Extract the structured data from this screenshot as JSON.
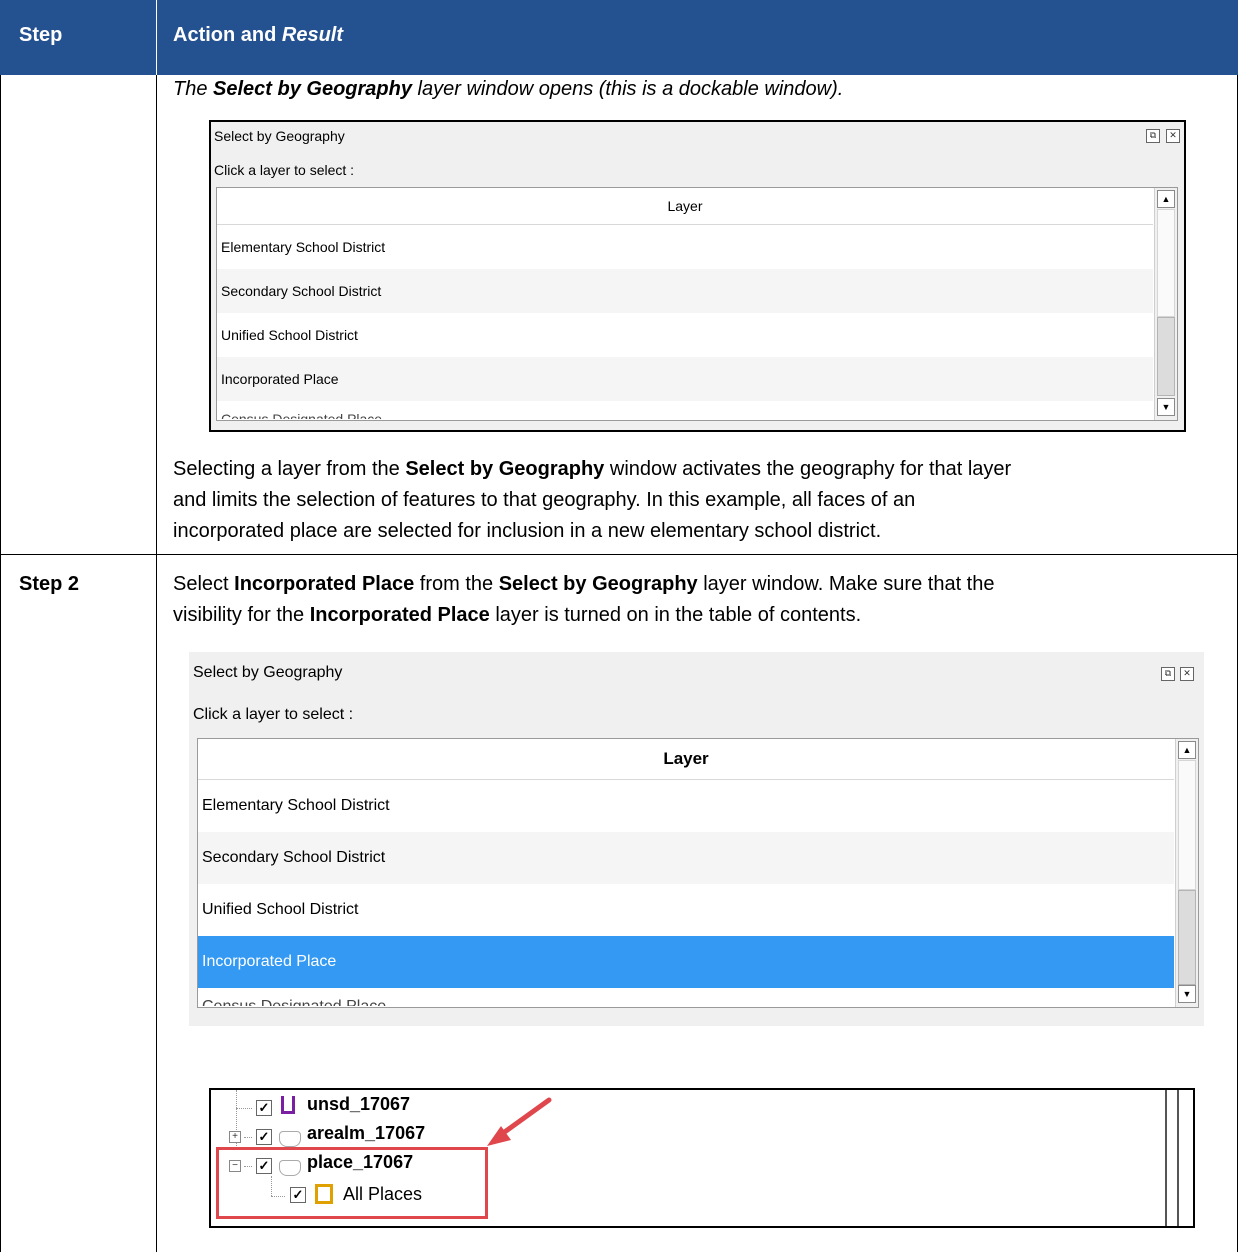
{
  "header": {
    "step_col": "Step",
    "action_col_prefix": "Action and ",
    "action_col_italic": "Result"
  },
  "row1": {
    "result_pre": "The ",
    "result_bold": "Select by Geography",
    "result_post": " layer window opens (this is a dockable window).",
    "explain_pre": "Selecting a layer from the ",
    "explain_bold": "Select by Geography",
    "explain_post_line1": " window activates the geography for that layer",
    "explain_line2": "and limits the selection of features to that geography. In this example, all faces of an",
    "explain_line3": "incorporated place are selected for inclusion in a new elementary school district."
  },
  "row2": {
    "step_label": "Step 2",
    "instr_a": "Select ",
    "instr_b": "Incorporated Place",
    "instr_c": " from the ",
    "instr_d": "Select by Geography",
    "instr_e": " layer window. Make sure that the",
    "instr2_a": "visibility for the ",
    "instr2_b": "Incorporated Place",
    "instr2_c": " layer is turned on in the table of contents."
  },
  "dialog": {
    "title": "Select by Geography",
    "prompt": "Click a layer to select :",
    "column_header": "Layer",
    "rows": [
      "Elementary School District",
      "Secondary School District",
      "Unified School District",
      "Incorporated Place",
      "Census Designated Place"
    ],
    "float_icon": "⧉",
    "close_icon": "✕",
    "selection_color": "#3399f3"
  },
  "toc": {
    "items": [
      "unsd_17067",
      "arealm_17067",
      "place_17067",
      "All Places"
    ],
    "check": "✓",
    "expand_plus": "+",
    "expand_minus": "−",
    "highlight_color": "#e0474c"
  }
}
